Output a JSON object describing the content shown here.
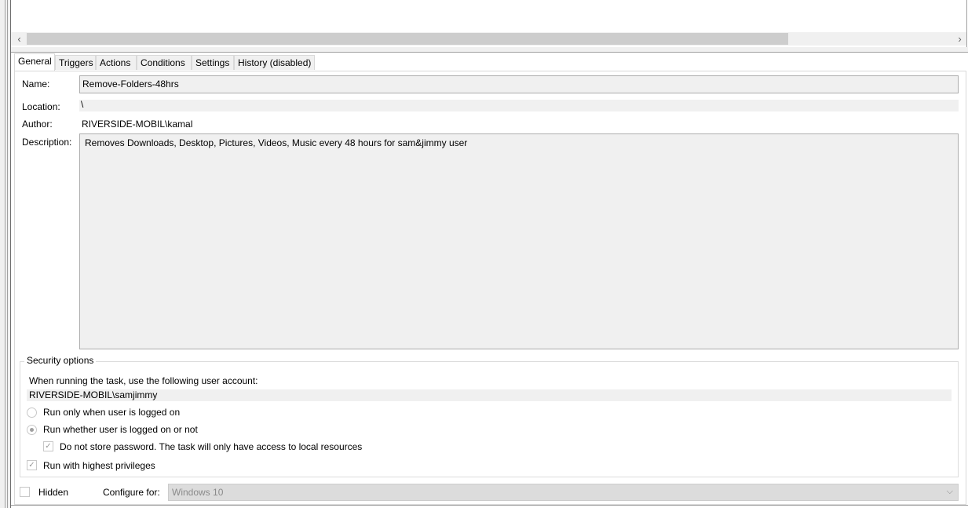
{
  "tabs": [
    {
      "label": "General",
      "active": true
    },
    {
      "label": "Triggers"
    },
    {
      "label": "Actions"
    },
    {
      "label": "Conditions"
    },
    {
      "label": "Settings"
    },
    {
      "label": "History (disabled)"
    }
  ],
  "general": {
    "name_label": "Name:",
    "name_value": "Remove-Folders-48hrs",
    "location_label": "Location:",
    "location_value": "\\",
    "author_label": "Author:",
    "author_value": "RIVERSIDE-MOBIL\\kamal",
    "description_label": "Description:",
    "description_value": "Removes Downloads, Desktop, Pictures, Videos, Music every 48 hours for sam&jimmy user"
  },
  "security": {
    "legend": "Security options",
    "account_prompt": "When running the task, use the following user account:",
    "account_value": "RIVERSIDE-MOBIL\\samjimmy",
    "radio_logged_on": {
      "label": "Run only when user is logged on",
      "checked": false
    },
    "radio_whether": {
      "label": "Run whether user is logged on or not",
      "checked": true
    },
    "do_not_store": {
      "label": "Do not store password.  The task will only have access to local resources",
      "checked": true
    },
    "highest_priv": {
      "label": "Run with highest privileges",
      "checked": true
    }
  },
  "footer": {
    "hidden_label": "Hidden",
    "hidden_checked": false,
    "configure_label": "Configure for:",
    "configure_value": "Windows 10"
  },
  "scrollbar": {
    "left_arrow": "‹",
    "right_arrow": "›"
  },
  "icons": {
    "check": "✓",
    "dropdown": "⌵"
  }
}
